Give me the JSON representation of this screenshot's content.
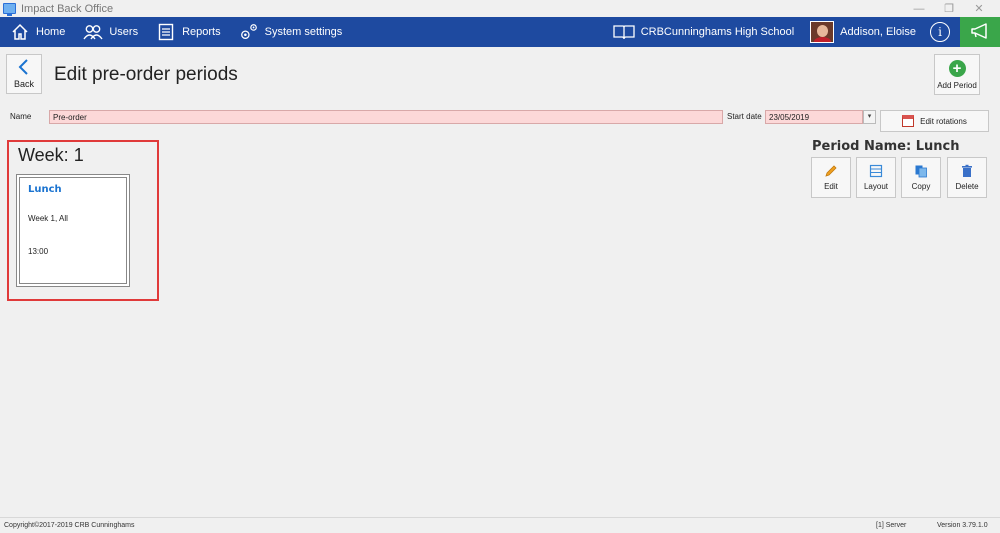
{
  "window": {
    "title": "Impact Back Office",
    "controls": {
      "minimize": "—",
      "restore": "❐",
      "close": "✕"
    }
  },
  "nav": {
    "items": [
      {
        "label": "Home",
        "icon": "home-icon"
      },
      {
        "label": "Users",
        "icon": "users-icon"
      },
      {
        "label": "Reports",
        "icon": "reports-icon"
      },
      {
        "label": "System settings",
        "icon": "settings-icon"
      }
    ],
    "school": "CRBCunninghams High School",
    "user": "Addison, Eloise",
    "info": "i",
    "colors": {
      "bar": "#1e4aa0",
      "announce": "#3aa64a"
    }
  },
  "header": {
    "back_label": "Back",
    "title": "Edit pre-order periods",
    "add_period_label": "Add Period"
  },
  "form": {
    "name_label": "Name",
    "name_value": "Pre-order",
    "start_date_label": "Start date",
    "start_date_value": "23/05/2019",
    "edit_rotations_label": "Edit rotations"
  },
  "week": {
    "title": "Week: 1",
    "cards": [
      {
        "name": "Lunch",
        "week": "Week 1, All",
        "time": "13:00"
      }
    ]
  },
  "period_panel": {
    "title": "Period Name: Lunch",
    "actions": [
      {
        "label": "Edit",
        "icon": "pencil-icon"
      },
      {
        "label": "Layout",
        "icon": "layout-icon"
      },
      {
        "label": "Copy",
        "icon": "copy-icon"
      },
      {
        "label": "Delete",
        "icon": "trash-icon"
      }
    ]
  },
  "footer": {
    "copyright": "Copyright©2017-2019 CRB Cunninghams",
    "server": "[1] Server",
    "version": "Version 3.79.1.0"
  }
}
